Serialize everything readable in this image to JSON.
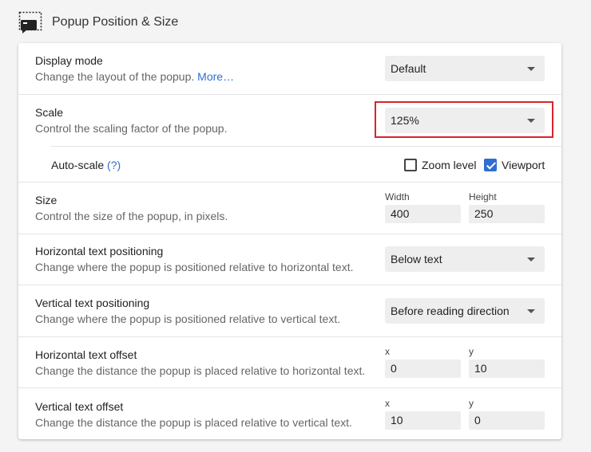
{
  "section": {
    "title": "Popup Position & Size",
    "icon": "popup-window-icon"
  },
  "display_mode": {
    "label": "Display mode",
    "description": "Change the layout of the popup.",
    "more_link": "More…",
    "value": "Default"
  },
  "scale": {
    "label": "Scale",
    "description": "Control the scaling factor of the popup.",
    "value": "125%"
  },
  "auto_scale": {
    "label": "Auto-scale",
    "help_link": "(?)",
    "zoom_level": {
      "label": "Zoom level",
      "checked": false
    },
    "viewport": {
      "label": "Viewport",
      "checked": true
    }
  },
  "size": {
    "label": "Size",
    "description": "Control the size of the popup, in pixels.",
    "width_label": "Width",
    "width_value": "400",
    "height_label": "Height",
    "height_value": "250"
  },
  "horizontal_positioning": {
    "label": "Horizontal text positioning",
    "description": "Change where the popup is positioned relative to horizontal text.",
    "value": "Below text"
  },
  "vertical_positioning": {
    "label": "Vertical text positioning",
    "description": "Change where the popup is positioned relative to vertical text.",
    "value": "Before reading direction"
  },
  "horizontal_offset": {
    "label": "Horizontal text offset",
    "description": "Change the distance the popup is placed relative to horizontal text.",
    "x_label": "x",
    "x_value": "0",
    "y_label": "y",
    "y_value": "10"
  },
  "vertical_offset": {
    "label": "Vertical text offset",
    "description": "Change the distance the popup is placed relative to vertical text.",
    "x_label": "x",
    "x_value": "10",
    "y_label": "y",
    "y_value": "0"
  },
  "colors": {
    "accent": "#2f6fd1",
    "highlight_border": "#d9232a"
  }
}
